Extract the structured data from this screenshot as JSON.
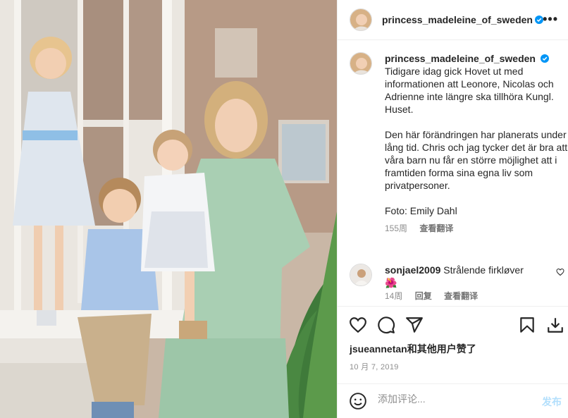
{
  "post": {
    "username": "princess_madeleine_of_sweden",
    "more_icon": "more-horizontal-icon"
  },
  "caption": {
    "username": "princess_madeleine_of_sweden",
    "text": "Tidigare idag gick Hovet ut med informationen att Leonore, Nicolas och Adrienne inte längre ska tillhöra Kungl. Huset.\n\nDen här förändringen har planerats under lång tid. Chris och jag tycker det är bra att våra barn nu får en större möjlighet att i framtiden forma sina egna liv som privatpersoner.\n\nFoto: Emily Dahl",
    "age": "155周",
    "translate": "查看翻译"
  },
  "comment": {
    "username": "sonjael2009",
    "text": "Strålende firkløver",
    "emoji": "🌺",
    "age": "14周",
    "reply": "回复",
    "translate": "查看翻译"
  },
  "likes": {
    "user": "jsueannetan",
    "suffix": "和其他用户赞了"
  },
  "date": "10 月 7, 2019",
  "add_comment": {
    "placeholder": "添加评论...",
    "post_label": "发布"
  },
  "colors": {
    "accent": "#0095f6",
    "muted": "#8e8e8e",
    "dress": "#a9cfb3"
  }
}
